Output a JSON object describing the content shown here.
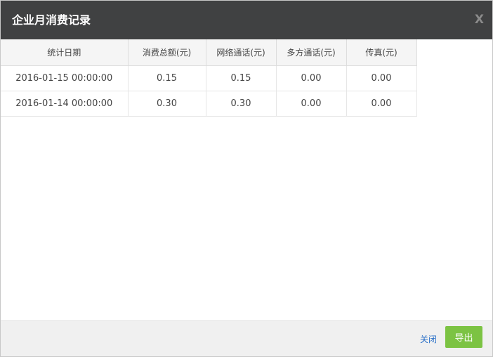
{
  "dialog": {
    "title": "企业月消费记录",
    "close_label": "X"
  },
  "table": {
    "headers": [
      "统计日期",
      "消费总额(元)",
      "网络通话(元)",
      "多方通话(元)",
      "传真(元)"
    ],
    "rows": [
      [
        "2016-01-15 00:00:00",
        "0.15",
        "0.15",
        "0.00",
        "0.00"
      ],
      [
        "2016-01-14 00:00:00",
        "0.30",
        "0.30",
        "0.00",
        "0.00"
      ]
    ]
  },
  "footer": {
    "close_link": "关闭",
    "export_label": "导出"
  },
  "colors": {
    "titlebar": "#404142",
    "export_button": "#7cc343",
    "link": "#2a70c8"
  }
}
